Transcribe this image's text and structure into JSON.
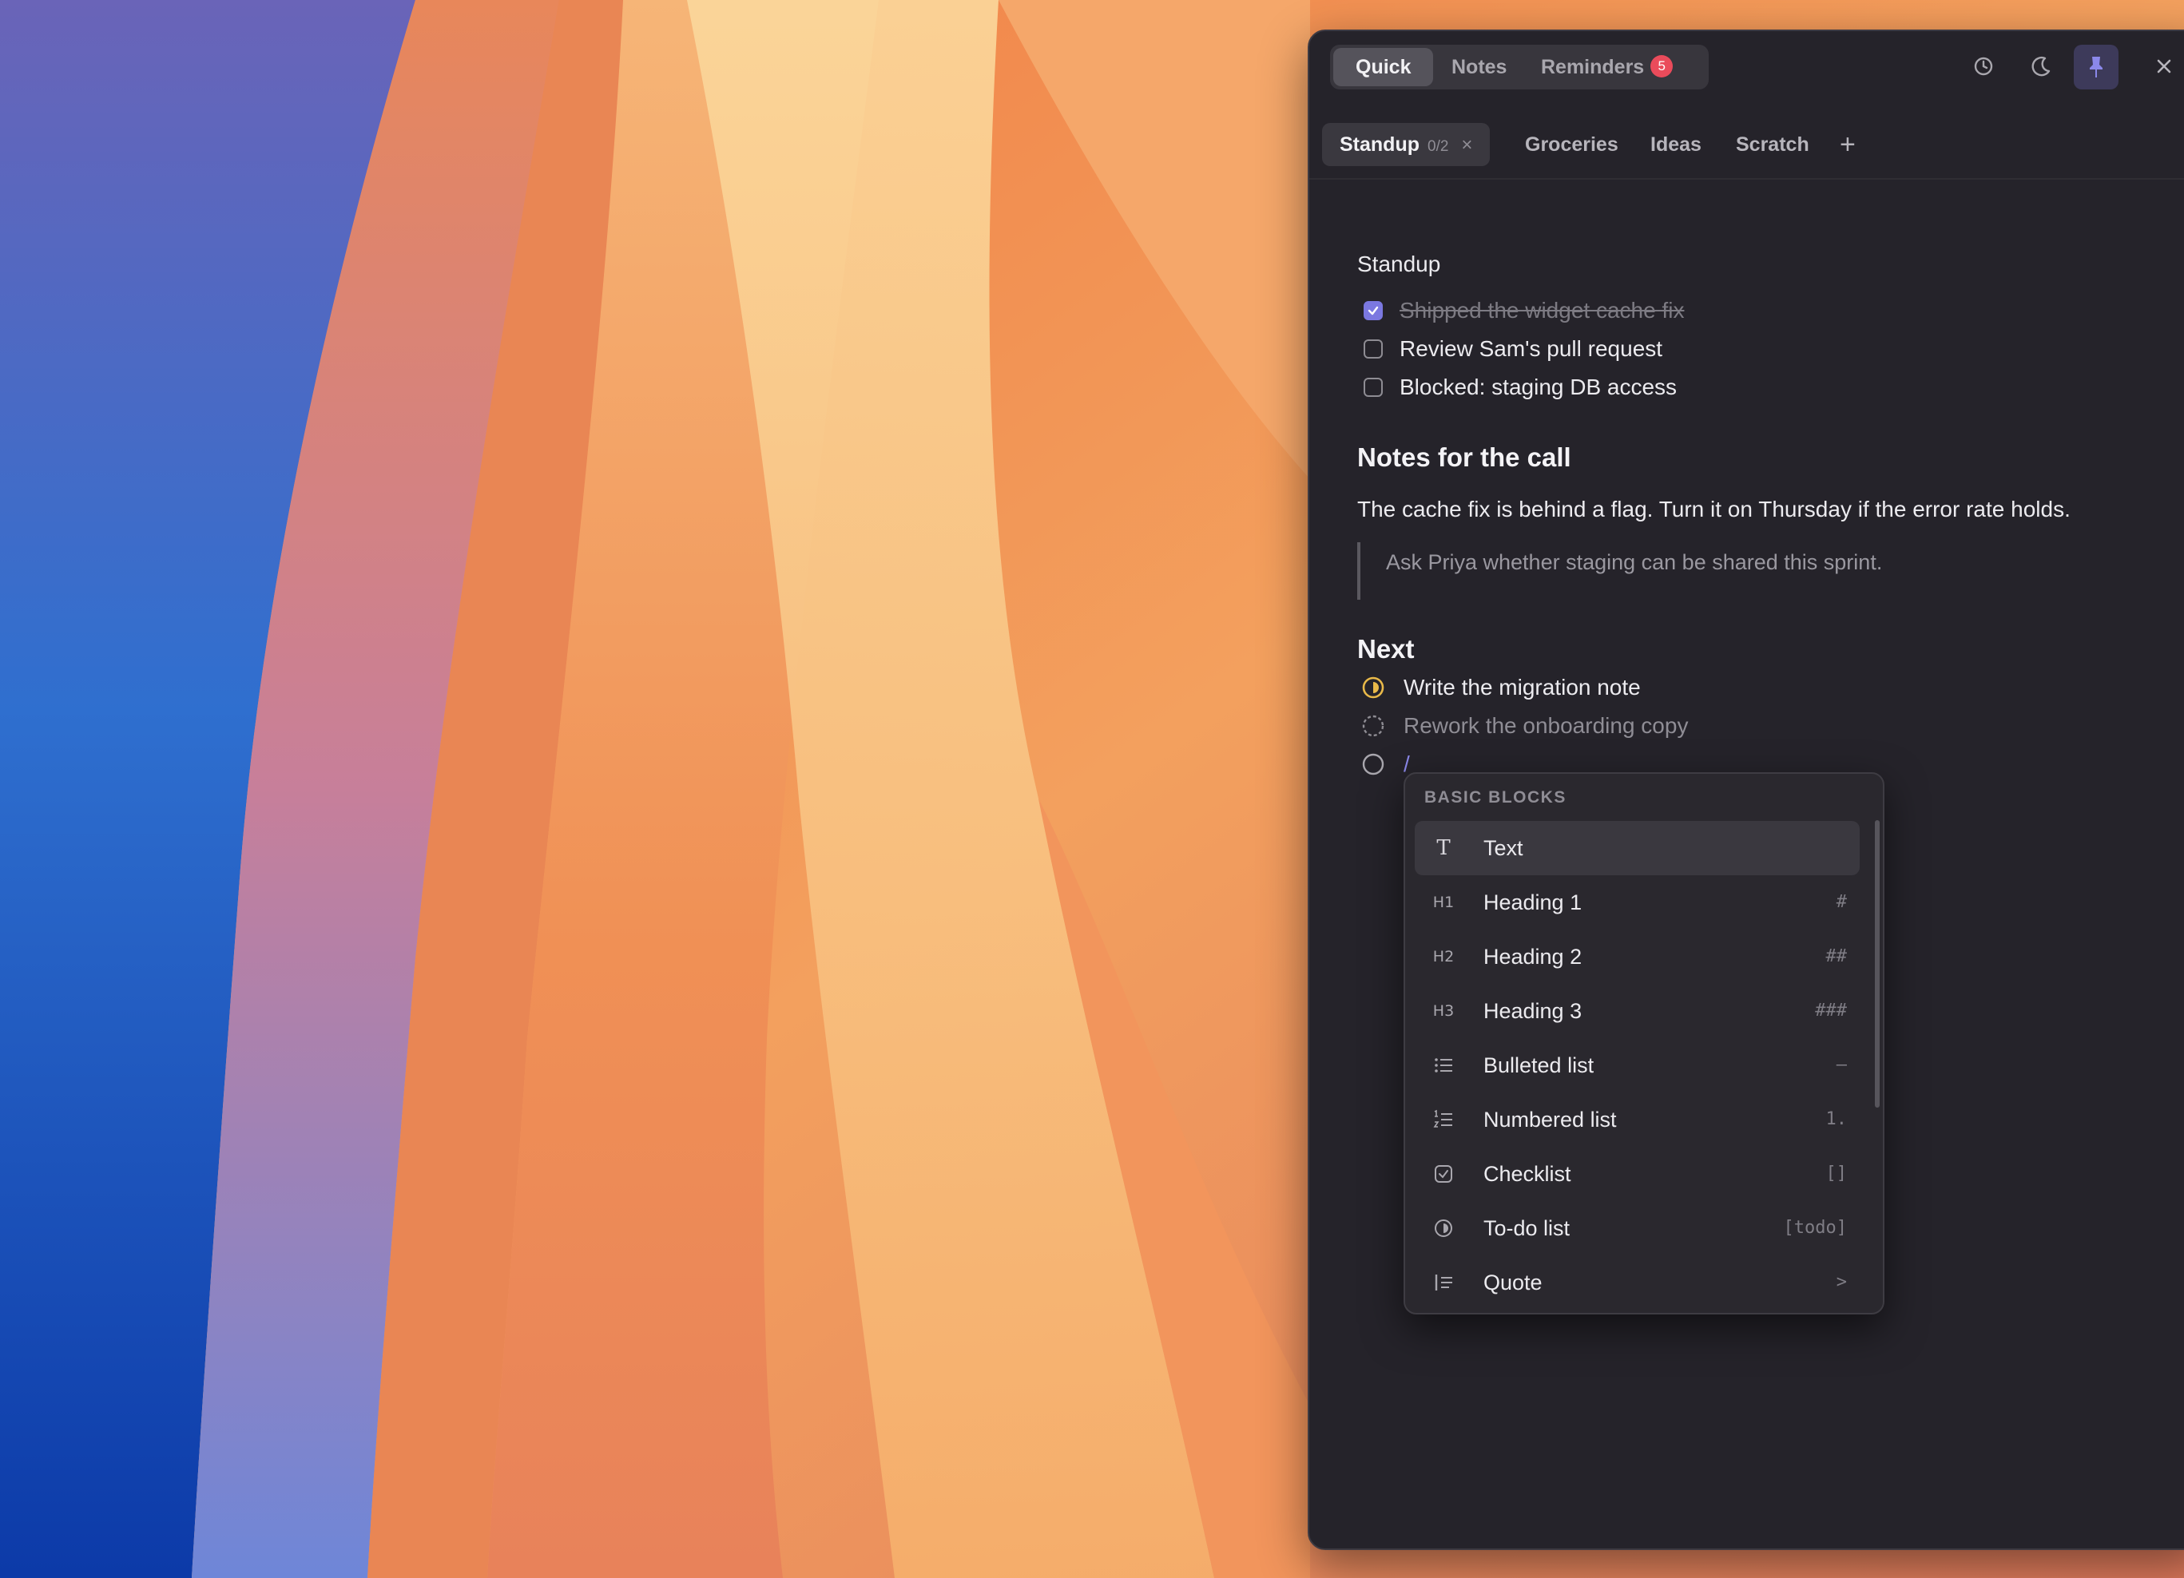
{
  "panel": {
    "segments": [
      {
        "label": "Quick",
        "active": true
      },
      {
        "label": "Notes",
        "active": false
      },
      {
        "label": "Reminders",
        "badge": "5",
        "active": false
      }
    ],
    "tabs": [
      {
        "label": "Standup",
        "count": "0/2",
        "close": "×",
        "active": true
      },
      {
        "label": "Groceries"
      },
      {
        "label": "Ideas"
      },
      {
        "label": "Scratch"
      }
    ],
    "add_tab": "+"
  },
  "note": {
    "title": "Standup",
    "checklist": [
      {
        "text": "Shipped the widget cache fix",
        "checked": true
      },
      {
        "text": "Review Sam's pull request",
        "checked": false
      },
      {
        "text": "Blocked: staging DB access",
        "checked": false
      }
    ],
    "section1_heading": "Notes for the call",
    "paragraph": "The cache fix is behind a flag. Turn it on Thursday if the error rate holds.",
    "quote": "Ask Priya whether staging can be shared this sprint.",
    "section2_heading": "Next",
    "todos": [
      {
        "text": "Write the migration note",
        "status": "in-progress"
      },
      {
        "text": "Rework the onboarding copy",
        "status": "pending"
      },
      {
        "text": "/",
        "status": "empty"
      }
    ]
  },
  "slash_menu": {
    "header": "BASIC BLOCKS",
    "items": [
      {
        "icon": "T",
        "label": "Text",
        "shortcut": "",
        "active": true
      },
      {
        "icon": "H1",
        "label": "Heading 1",
        "shortcut": "#"
      },
      {
        "icon": "H2",
        "label": "Heading 2",
        "shortcut": "##"
      },
      {
        "icon": "H3",
        "label": "Heading 3",
        "shortcut": "###"
      },
      {
        "icon": "bullet-list",
        "label": "Bulleted list",
        "shortcut": "–"
      },
      {
        "icon": "numbered-list",
        "label": "Numbered list",
        "shortcut": "1."
      },
      {
        "icon": "checklist",
        "label": "Checklist",
        "shortcut": "[]"
      },
      {
        "icon": "todo",
        "label": "To-do list",
        "shortcut": "[todo]"
      },
      {
        "icon": "quote",
        "label": "Quote",
        "shortcut": ">"
      }
    ]
  },
  "colors": {
    "accent": "#7b78e0",
    "badge": "#ea4b5b",
    "in_progress": "#e9b949",
    "panel_bg": "#25232a"
  }
}
